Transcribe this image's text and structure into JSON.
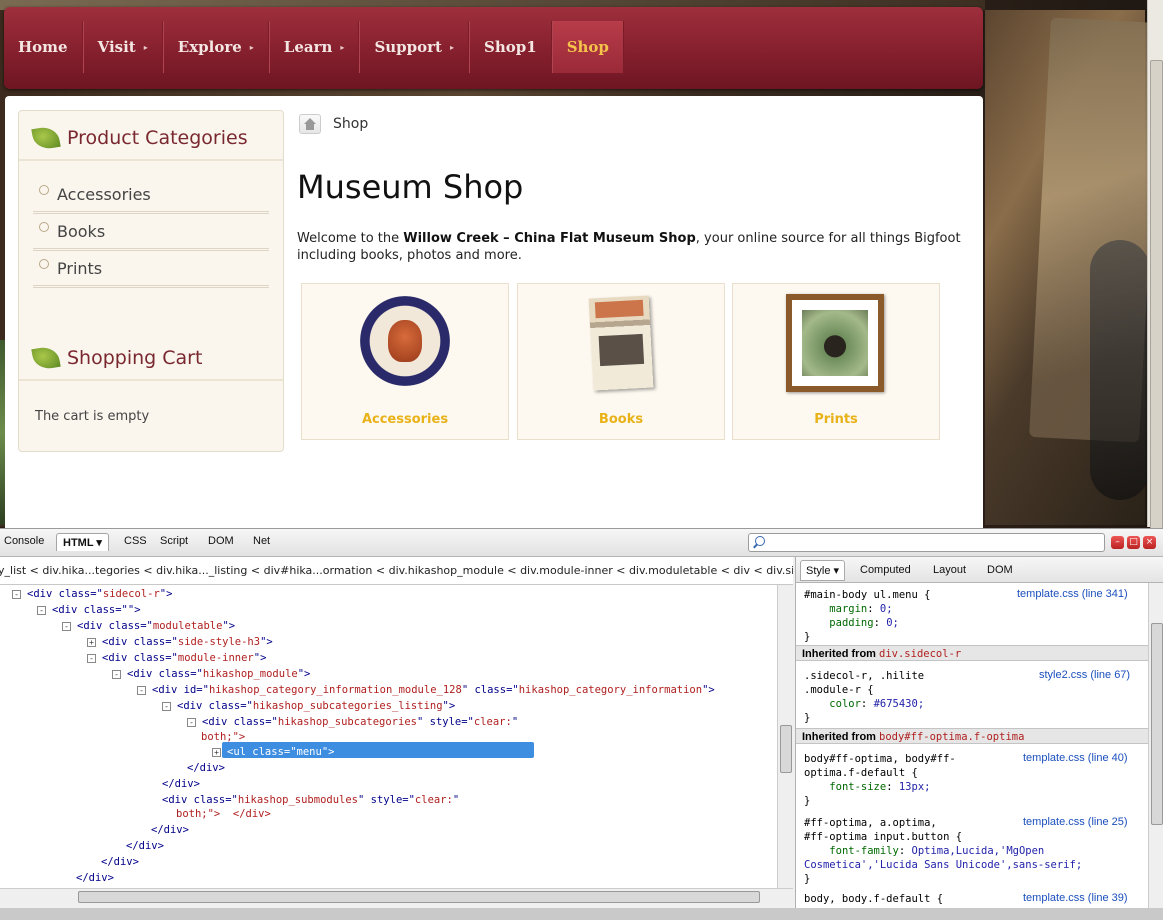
{
  "nav": {
    "items": [
      {
        "label": "Home",
        "caret": ""
      },
      {
        "label": "Visit",
        "caret": "▸"
      },
      {
        "label": "Explore",
        "caret": "▸"
      },
      {
        "label": "Learn",
        "caret": "▸"
      },
      {
        "label": "Support",
        "caret": "▸"
      },
      {
        "label": "Shop1",
        "caret": ""
      },
      {
        "label": "Shop",
        "caret": ""
      }
    ]
  },
  "sidebar": {
    "categories_title": "Product Categories",
    "categories": [
      "Accessories",
      "Books",
      "Prints"
    ],
    "cart_title": "Shopping Cart",
    "cart_text": "The cart is empty"
  },
  "main": {
    "breadcrumb": "Shop",
    "title": "Museum Shop",
    "intro_pre": "Welcome to the ",
    "intro_bold": "Willow Creek – China Flat Museum Shop",
    "intro_post": ", your online source for all things Bigfoot including books, photos and more.",
    "tiles": [
      "Accessories",
      "Books",
      "Prints"
    ]
  },
  "firebug": {
    "tabs": [
      "Console",
      "HTML ▾",
      "CSS",
      "Script",
      "DOM",
      "Net"
    ],
    "window_buttons": [
      "–",
      "□",
      "×"
    ],
    "breadcrumb": "y_list < div.hika...tegories < div.hika..._listing < div#hika...ormation < div.hikashop_module < div.module-inner < div.moduletable < div < div.side",
    "tree": [
      {
        "t": "-",
        "pre": "<",
        "tag": "div",
        "a": [
          [
            "class",
            "sidecol-r"
          ]
        ],
        "post": ">"
      },
      {
        "t": "-",
        "pre": "<",
        "tag": "div",
        "a": [
          [
            "class",
            ""
          ]
        ],
        "post": ">"
      },
      {
        "t": "-",
        "pre": "<",
        "tag": "div",
        "a": [
          [
            "class",
            "moduletable"
          ]
        ],
        "post": ">"
      },
      {
        "t": "+",
        "pre": "<",
        "tag": "div",
        "a": [
          [
            "class",
            "side-style-h3"
          ]
        ],
        "post": ">"
      },
      {
        "t": "-",
        "pre": "<",
        "tag": "div",
        "a": [
          [
            "class",
            "module-inner"
          ]
        ],
        "post": ">"
      },
      {
        "t": "-",
        "pre": "<",
        "tag": "div",
        "a": [
          [
            "class",
            "hikashop_module"
          ]
        ],
        "post": ">"
      },
      {
        "t": "-",
        "pre": "<",
        "tag": "div",
        "a": [
          [
            "id",
            "hikashop_category_information_module_128"
          ],
          [
            "class",
            "hikashop_category_information"
          ]
        ],
        "post": ">"
      },
      {
        "t": "-",
        "pre": "<",
        "tag": "div",
        "a": [
          [
            "class",
            "hikashop_subcategories_listing"
          ]
        ],
        "post": ">"
      },
      {
        "t": "-",
        "pre": "<",
        "tag": "div",
        "a": [
          [
            "class",
            "hikashop_subcategories"
          ],
          [
            "style",
            "clear:"
          ]
        ],
        "post": ""
      },
      {
        "t": "",
        "pre": "",
        "tag": "",
        "a": [],
        "post": "both;\">"
      },
      {
        "t": "+",
        "pre": "",
        "tag": "",
        "a": [],
        "post": "<ul class=\"menu\">"
      },
      {
        "t": "",
        "pre": "</",
        "tag": "div",
        "a": [],
        "post": ">"
      },
      {
        "t": "",
        "pre": "</",
        "tag": "div",
        "a": [],
        "post": ">"
      },
      {
        "t": "",
        "pre": "<",
        "tag": "div",
        "a": [
          [
            "class",
            "hikashop_submodules"
          ],
          [
            "style",
            "clear:"
          ]
        ],
        "post": ""
      },
      {
        "t": "",
        "pre": "",
        "tag": "",
        "a": [],
        "post": "both;\">  </div>"
      },
      {
        "t": "",
        "pre": "</",
        "tag": "div",
        "a": [],
        "post": ">"
      },
      {
        "t": "",
        "pre": "</",
        "tag": "div",
        "a": [],
        "post": ">"
      },
      {
        "t": "",
        "pre": "</",
        "tag": "div",
        "a": [],
        "post": ">"
      },
      {
        "t": "",
        "pre": "</",
        "tag": "div",
        "a": [],
        "post": ">"
      },
      {
        "t": "",
        "pre": "</",
        "tag": "div",
        "a": [],
        "post": ">"
      }
    ],
    "side_tabs": [
      "Style ▾",
      "Computed",
      "Layout",
      "DOM"
    ],
    "rules": {
      "r1": {
        "sel": "#main-body ul.menu {",
        "src": "template.css (line 341)",
        "props": [
          [
            "margin",
            "0;"
          ],
          [
            "padding",
            "0;"
          ]
        ]
      },
      "inh1": {
        "label": "Inherited from",
        "sel": "div.sidecol-r"
      },
      "r2": {
        "sel1": ".sidecol-r, .hilite",
        "sel2": ".module-r {",
        "src": "style2.css (line 67)",
        "props": [
          [
            "color",
            "#675430;"
          ]
        ]
      },
      "inh2": {
        "label": "Inherited from",
        "sel": "body#ff-optima.f-optima"
      },
      "r3": {
        "sel1": "body#ff-optima, body#ff-",
        "sel2": "optima.f-default {",
        "src": "template.css (line 40)",
        "props": [
          [
            "font-size",
            "13px;"
          ]
        ]
      },
      "r4": {
        "sel1": "#ff-optima, a.optima,",
        "sel2": "#ff-optima input.button {",
        "src": "template.css (line 25)",
        "props": [
          [
            "font-family",
            "Optima,Lucida,'MgOpen"
          ]
        ],
        "cont": "Cosmetica','Lucida Sans Unicode',sans-serif;"
      },
      "r5": {
        "sel": "body, body.f-default {",
        "src": "template.css (line 39)"
      },
      "close": "}"
    }
  },
  "colors": {
    "nav_active": "#f6c34a",
    "tile_label": "#e8b218",
    "sidebar_title": "#7a2830"
  }
}
